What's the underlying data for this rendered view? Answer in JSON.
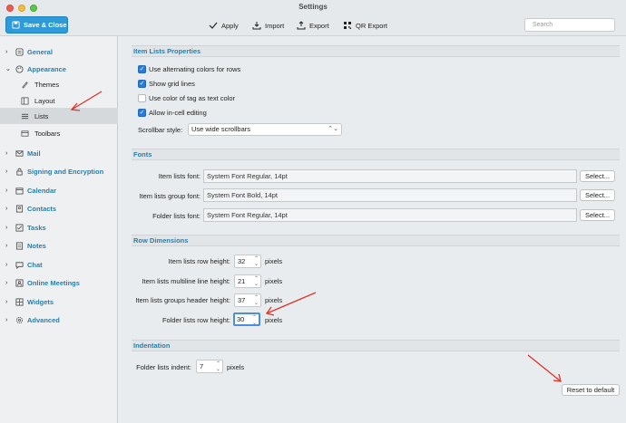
{
  "window": {
    "title": "Settings"
  },
  "toolbar": {
    "save_close_label": "Save & Close",
    "apply_label": "Apply",
    "import_label": "Import",
    "export_label": "Export",
    "qr_export_label": "QR Export",
    "search_placeholder": "Search"
  },
  "sidebar": {
    "items": [
      {
        "label": "General"
      },
      {
        "label": "Appearance"
      },
      {
        "label": "Themes"
      },
      {
        "label": "Layout"
      },
      {
        "label": "Lists"
      },
      {
        "label": "Toolbars"
      },
      {
        "label": "Mail"
      },
      {
        "label": "Signing and Encryption"
      },
      {
        "label": "Calendar"
      },
      {
        "label": "Contacts"
      },
      {
        "label": "Tasks"
      },
      {
        "label": "Notes"
      },
      {
        "label": "Chat"
      },
      {
        "label": "Online Meetings"
      },
      {
        "label": "Widgets"
      },
      {
        "label": "Advanced"
      }
    ]
  },
  "item_lists_properties": {
    "header": "Item Lists Properties",
    "alternating": {
      "label": "Use alternating colors for rows",
      "checked": true
    },
    "grid_lines": {
      "label": "Show grid lines",
      "checked": true
    },
    "tag_color": {
      "label": "Use color of tag as text color",
      "checked": false
    },
    "in_cell_editing": {
      "label": "Allow in-cell editing",
      "checked": true
    },
    "scrollbar_style_label": "Scrollbar style:",
    "scrollbar_style_value": "Use wide scrollbars"
  },
  "fonts": {
    "header": "Fonts",
    "item_lists_font_label": "Item lists font:",
    "item_lists_font_value": "System Font Regular, 14pt",
    "group_font_label": "Item lists group font:",
    "group_font_value": "System Font Bold, 14pt",
    "folder_font_label": "Folder lists font:",
    "folder_font_value": "System Font Regular, 14pt",
    "select_label": "Select..."
  },
  "row_dimensions": {
    "header": "Row Dimensions",
    "row_height_label": "Item lists row height:",
    "row_height_value": "32",
    "multiline_label": "Item lists multiline line height:",
    "multiline_value": "21",
    "groups_header_label": "Item lists groups header height:",
    "groups_header_value": "37",
    "folder_row_label": "Folder lists row height:",
    "folder_row_value": "30",
    "unit": "pixels"
  },
  "indentation": {
    "header": "Indentation",
    "indent_label": "Folder lists indent:",
    "indent_value": "7",
    "unit": "pixels"
  },
  "reset_label": "Reset to default",
  "colors": {
    "accent": "#2a7ea8",
    "save_button": "#2e9bd8",
    "checkbox": "#2a7bd8",
    "annotation_arrow": "#e0322b"
  }
}
